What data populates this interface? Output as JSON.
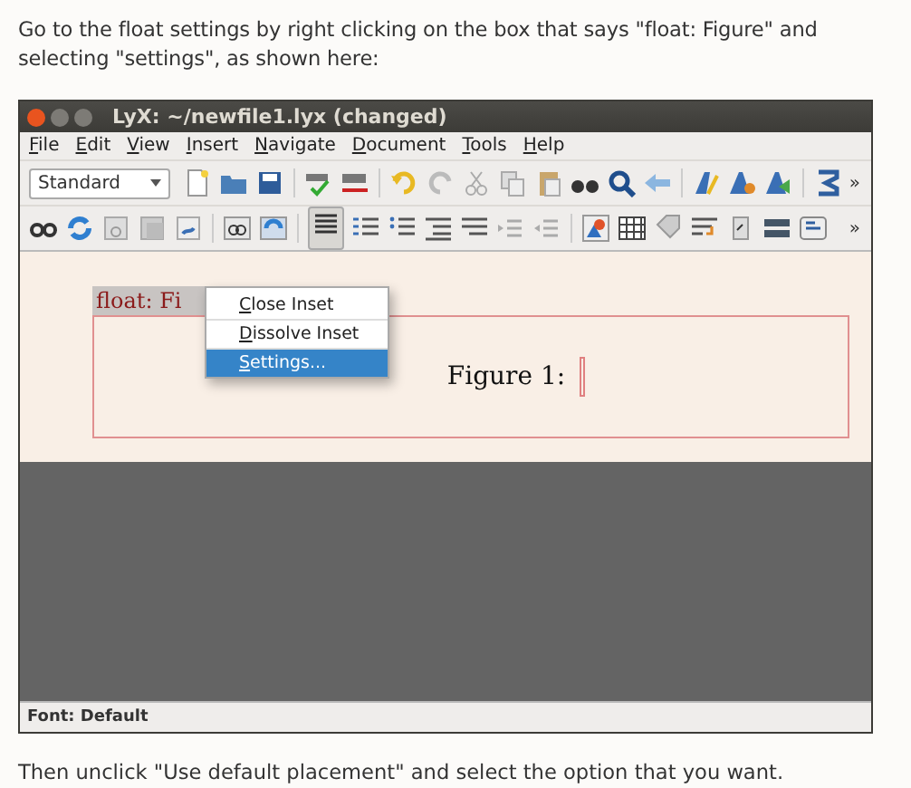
{
  "intro": "Go to the float settings by right clicking on the box that says \"float: Figure\" and selecting \"settings\", as shown here:",
  "window": {
    "title": "LyX: ~/newfile1.lyx (changed)",
    "menu": [
      {
        "label": "File"
      },
      {
        "label": "Edit"
      },
      {
        "label": "View"
      },
      {
        "label": "Insert"
      },
      {
        "label": "Navigate"
      },
      {
        "label": "Document"
      },
      {
        "label": "Tools"
      },
      {
        "label": "Help"
      }
    ],
    "layout_combo": {
      "value": "Standard"
    },
    "toolbar_overflow": [
      "»",
      "»"
    ],
    "document": {
      "float_label": "float: Fi",
      "caption": "Figure 1:",
      "context_menu": [
        {
          "label": "Close Inset",
          "selected": false
        },
        {
          "label": "Dissolve Inset",
          "selected": false
        },
        {
          "label": "Settings...",
          "selected": true
        }
      ]
    },
    "status_bar": "Font: Default"
  },
  "outro": "Then unclick \"Use default placement\" and select the option that you want."
}
